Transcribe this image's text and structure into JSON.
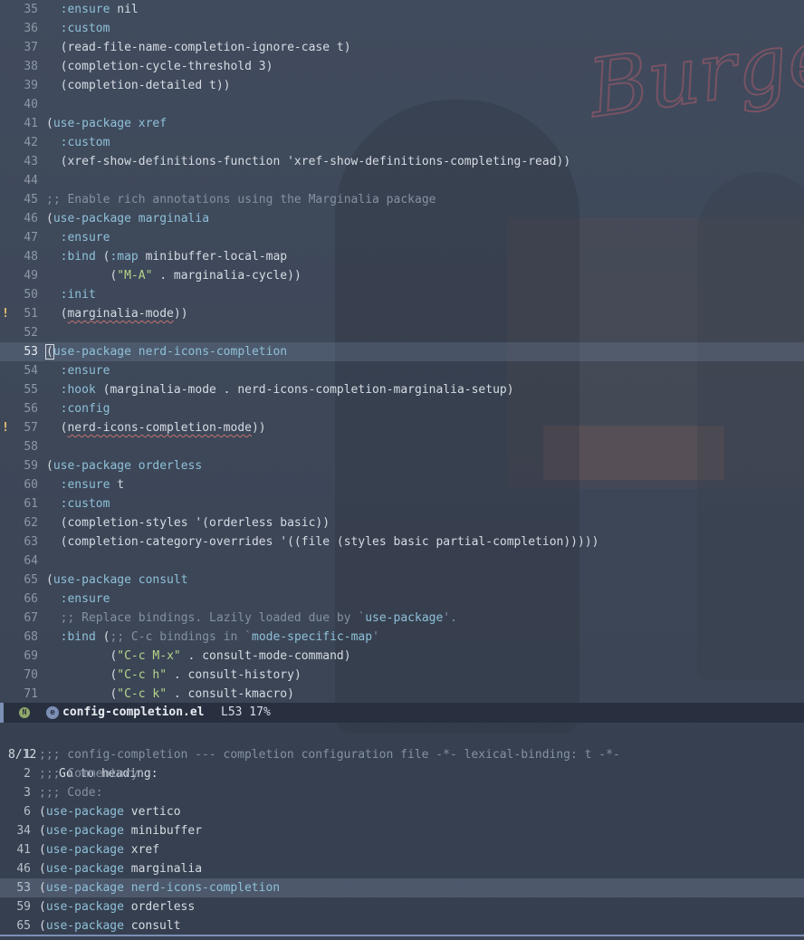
{
  "editor": {
    "lines": [
      {
        "num": "35",
        "segs": [
          {
            "t": "  "
          },
          {
            "t": ":ensure",
            "c": "kw"
          },
          {
            "t": " nil"
          }
        ]
      },
      {
        "num": "36",
        "segs": [
          {
            "t": "  "
          },
          {
            "t": ":custom",
            "c": "kw"
          }
        ]
      },
      {
        "num": "37",
        "segs": [
          {
            "t": "  (read-file-name-completion-ignore-case t)"
          }
        ]
      },
      {
        "num": "38",
        "segs": [
          {
            "t": "  (completion-cycle-threshold 3)"
          }
        ]
      },
      {
        "num": "39",
        "segs": [
          {
            "t": "  (completion-detailed t))"
          }
        ]
      },
      {
        "num": "40",
        "segs": []
      },
      {
        "num": "41",
        "segs": [
          {
            "t": "("
          },
          {
            "t": "use-package",
            "c": "kw"
          },
          {
            "t": " "
          },
          {
            "t": "xref",
            "c": "kw"
          }
        ]
      },
      {
        "num": "42",
        "segs": [
          {
            "t": "  "
          },
          {
            "t": ":custom",
            "c": "kw"
          }
        ]
      },
      {
        "num": "43",
        "segs": [
          {
            "t": "  (xref-show-definitions-function 'xref-show-definitions-completing-read))"
          }
        ]
      },
      {
        "num": "44",
        "segs": []
      },
      {
        "num": "45",
        "segs": [
          {
            "t": ";; Enable rich annotations using the Marginalia package",
            "c": "cmt"
          }
        ]
      },
      {
        "num": "46",
        "segs": [
          {
            "t": "("
          },
          {
            "t": "use-package",
            "c": "kw"
          },
          {
            "t": " "
          },
          {
            "t": "marginalia",
            "c": "kw"
          }
        ]
      },
      {
        "num": "47",
        "segs": [
          {
            "t": "  "
          },
          {
            "t": ":ensure",
            "c": "kw"
          }
        ]
      },
      {
        "num": "48",
        "segs": [
          {
            "t": "  "
          },
          {
            "t": ":bind",
            "c": "kw"
          },
          {
            "t": " ("
          },
          {
            "t": ":map",
            "c": "kw"
          },
          {
            "t": " minibuffer-local-map"
          }
        ]
      },
      {
        "num": "49",
        "segs": [
          {
            "t": "         ("
          },
          {
            "t": "\"M-A\"",
            "c": "str"
          },
          {
            "t": " . marginalia-cycle))"
          }
        ]
      },
      {
        "num": "50",
        "segs": [
          {
            "t": "  "
          },
          {
            "t": ":init",
            "c": "kw"
          }
        ]
      },
      {
        "num": "51",
        "flag": "!",
        "segs": [
          {
            "t": "  ("
          },
          {
            "t": "marginalia-mode",
            "c": "sq"
          },
          {
            "t": "))"
          }
        ]
      },
      {
        "num": "52",
        "segs": []
      },
      {
        "num": "53",
        "current": true,
        "segs": [
          {
            "t": "(",
            "c": "cursorbox"
          },
          {
            "t": "use-package",
            "c": "kw"
          },
          {
            "t": " "
          },
          {
            "t": "nerd-icons-completion",
            "c": "kw"
          }
        ]
      },
      {
        "num": "54",
        "segs": [
          {
            "t": "  "
          },
          {
            "t": ":ensure",
            "c": "kw"
          }
        ]
      },
      {
        "num": "55",
        "segs": [
          {
            "t": "  "
          },
          {
            "t": ":hook",
            "c": "kw"
          },
          {
            "t": " (marginalia-mode . nerd-icons-completion-marginalia-setup)"
          }
        ]
      },
      {
        "num": "56",
        "segs": [
          {
            "t": "  "
          },
          {
            "t": ":config",
            "c": "kw"
          }
        ]
      },
      {
        "num": "57",
        "flag": "!",
        "segs": [
          {
            "t": "  ("
          },
          {
            "t": "nerd-icons-completion-mode",
            "c": "sq"
          },
          {
            "t": "))"
          }
        ]
      },
      {
        "num": "58",
        "segs": []
      },
      {
        "num": "59",
        "segs": [
          {
            "t": "("
          },
          {
            "t": "use-package",
            "c": "kw"
          },
          {
            "t": " "
          },
          {
            "t": "orderless",
            "c": "kw"
          }
        ]
      },
      {
        "num": "60",
        "segs": [
          {
            "t": "  "
          },
          {
            "t": ":ensure",
            "c": "kw"
          },
          {
            "t": " t"
          }
        ]
      },
      {
        "num": "61",
        "segs": [
          {
            "t": "  "
          },
          {
            "t": ":custom",
            "c": "kw"
          }
        ]
      },
      {
        "num": "62",
        "segs": [
          {
            "t": "  (completion-styles '(orderless basic))"
          }
        ]
      },
      {
        "num": "63",
        "segs": [
          {
            "t": "  (completion-category-overrides '((file (styles basic partial-completion)))))"
          }
        ]
      },
      {
        "num": "64",
        "segs": []
      },
      {
        "num": "65",
        "segs": [
          {
            "t": "("
          },
          {
            "t": "use-package",
            "c": "kw"
          },
          {
            "t": " "
          },
          {
            "t": "consult",
            "c": "kw"
          }
        ]
      },
      {
        "num": "66",
        "segs": [
          {
            "t": "  "
          },
          {
            "t": ":ensure",
            "c": "kw"
          }
        ]
      },
      {
        "num": "67",
        "segs": [
          {
            "t": "  ;; Replace bindings. Lazily loaded due by `",
            "c": "cmt"
          },
          {
            "t": "use-package",
            "c": "bq"
          },
          {
            "t": "'.",
            "c": "cmt"
          }
        ]
      },
      {
        "num": "68",
        "segs": [
          {
            "t": "  "
          },
          {
            "t": ":bind",
            "c": "kw"
          },
          {
            "t": " ("
          },
          {
            "t": ";; C-c bindings in `",
            "c": "cmt"
          },
          {
            "t": "mode-specific-map",
            "c": "bq"
          },
          {
            "t": "'",
            "c": "cmt"
          }
        ]
      },
      {
        "num": "69",
        "segs": [
          {
            "t": "         ("
          },
          {
            "t": "\"C-c M-x\"",
            "c": "str"
          },
          {
            "t": " . consult-mode-command)"
          }
        ]
      },
      {
        "num": "70",
        "segs": [
          {
            "t": "         ("
          },
          {
            "t": "\"C-c h\"",
            "c": "str"
          },
          {
            "t": " . consult-history)"
          }
        ]
      },
      {
        "num": "71",
        "segs": [
          {
            "t": "         ("
          },
          {
            "t": "\"C-c k\"",
            "c": "str"
          },
          {
            "t": " . consult-kmacro)"
          }
        ]
      }
    ]
  },
  "modeline": {
    "state_letter": "N",
    "emacs_glyph": "e",
    "filename": "config-completion.el",
    "position": "L53 17%"
  },
  "minibuffer": {
    "count": "8/12",
    "prompt": "Go to heading:",
    "candidates": [
      {
        "num": "1",
        "segs": [
          {
            "t": ";;; config-completion --- completion configuration file -*- lexical-binding: t -*-",
            "c": "cmt"
          }
        ]
      },
      {
        "num": "2",
        "segs": [
          {
            "t": ";;; Commentary:",
            "c": "cmt"
          }
        ]
      },
      {
        "num": "3",
        "segs": [
          {
            "t": ";;; Code:",
            "c": "cmt"
          }
        ]
      },
      {
        "num": "6",
        "segs": [
          {
            "t": "("
          },
          {
            "t": "use-package",
            "c": "kw"
          },
          {
            "t": " vertico"
          }
        ]
      },
      {
        "num": "34",
        "segs": [
          {
            "t": "("
          },
          {
            "t": "use-package",
            "c": "kw"
          },
          {
            "t": " minibuffer"
          }
        ]
      },
      {
        "num": "41",
        "segs": [
          {
            "t": "("
          },
          {
            "t": "use-package",
            "c": "kw"
          },
          {
            "t": " xref"
          }
        ]
      },
      {
        "num": "46",
        "segs": [
          {
            "t": "("
          },
          {
            "t": "use-package",
            "c": "kw"
          },
          {
            "t": " marginalia"
          }
        ]
      },
      {
        "num": "53",
        "selected": true,
        "segs": [
          {
            "t": "("
          },
          {
            "t": "use-package",
            "c": "kw"
          },
          {
            "t": " "
          },
          {
            "t": "nerd-icons-completion",
            "c": "kw"
          }
        ]
      },
      {
        "num": "59",
        "segs": [
          {
            "t": "("
          },
          {
            "t": "use-package",
            "c": "kw"
          },
          {
            "t": " orderless"
          }
        ]
      },
      {
        "num": "65",
        "segs": [
          {
            "t": "("
          },
          {
            "t": "use-package",
            "c": "kw"
          },
          {
            "t": " consult"
          }
        ]
      }
    ]
  },
  "colors": {
    "background": "#3b4556",
    "keyword": "#8ec0d8",
    "string": "#b7d48a",
    "comment": "#8590a2",
    "modeline": "#283040",
    "accent": "#7c8fb4",
    "warning": "#f0c674"
  }
}
